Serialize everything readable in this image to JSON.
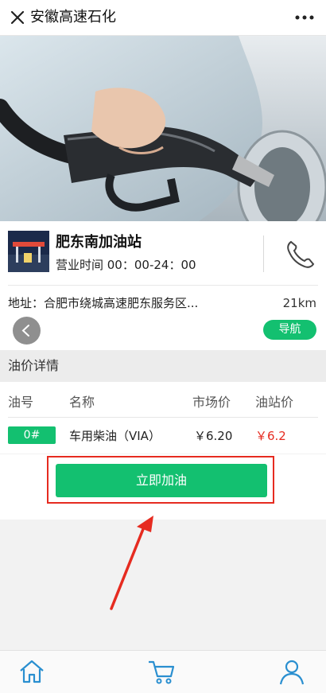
{
  "header": {
    "title": "安徽高速石化",
    "close_icon": "close-icon",
    "more_icon": "more-icon"
  },
  "station": {
    "name": "肥东南加油站",
    "hours": "营业时间 00：00-24：00",
    "address": "地址：合肥市绕城高速肥东服务区...",
    "distance": "21km",
    "nav_label": "导航"
  },
  "section": {
    "title": "油价详情"
  },
  "price_table": {
    "headers": [
      "油号",
      "名称",
      "市场价",
      "油站价"
    ],
    "rows": [
      {
        "grade": "0#",
        "name": "车用柴油（VIA）",
        "market": "￥6.20",
        "station": "￥6.2"
      }
    ]
  },
  "action": {
    "refuel_label": "立即加油"
  },
  "tabbar": {
    "items": [
      "home-icon",
      "cart-icon",
      "user-icon"
    ]
  },
  "colors": {
    "accent": "#13c070",
    "price_red": "#e62b20",
    "annotation": "#e62b20"
  }
}
